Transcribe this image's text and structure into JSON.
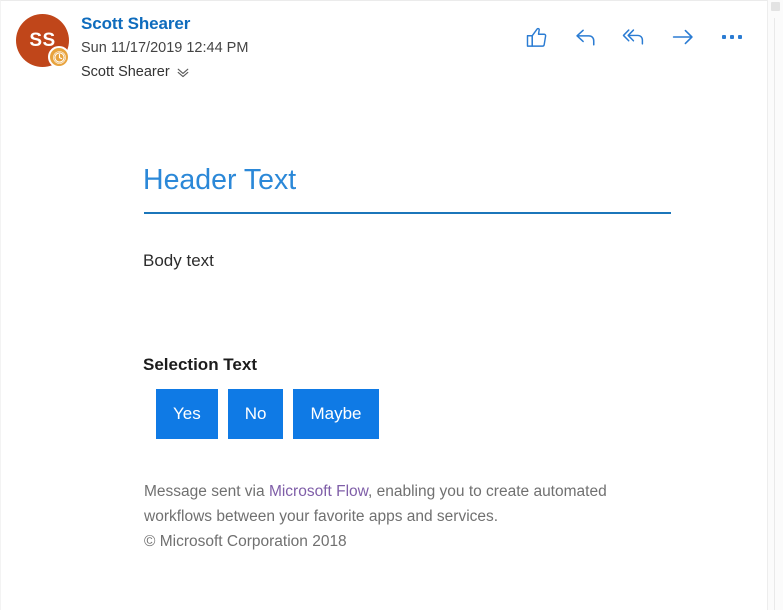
{
  "message": {
    "sender": {
      "initials": "SS",
      "display_name": "Scott Shearer",
      "avatar_color": "#c0461a",
      "badge_icon": "clock-icon",
      "badge_color": "#e8a33d"
    },
    "timestamp": "Sun 11/17/2019 12:44 PM",
    "recipients": "Scott Shearer",
    "recipients_expand_icon": "double-chevron-down-icon"
  },
  "toolbar": {
    "like_label": "Like",
    "like_icon": "thumbs-up-icon",
    "reply_label": "Reply",
    "reply_icon": "reply-arrow-icon",
    "reply_all_label": "Reply all",
    "reply_all_icon": "reply-all-arrow-icon",
    "forward_label": "Forward",
    "forward_icon": "forward-arrow-icon",
    "more_label": "More actions",
    "more_icon": "ellipsis-icon",
    "accent_color": "#2b7cd3"
  },
  "body": {
    "header_text": "Header Text",
    "header_color": "#2b88d8",
    "rule_color": "#1b76ba",
    "body_text": "Body text",
    "selection_label": "Selection Text",
    "choices": [
      {
        "label": "Yes"
      },
      {
        "label": "No"
      },
      {
        "label": "Maybe"
      }
    ],
    "choice_color": "#0f7ae5"
  },
  "footer": {
    "prefix": "Message sent via ",
    "link_text": "Microsoft Flow",
    "link_color": "#7f5ea8",
    "suffix": ", enabling you to create automated workflows between your favorite apps and services.",
    "copyright": "© Microsoft Corporation 2018"
  }
}
